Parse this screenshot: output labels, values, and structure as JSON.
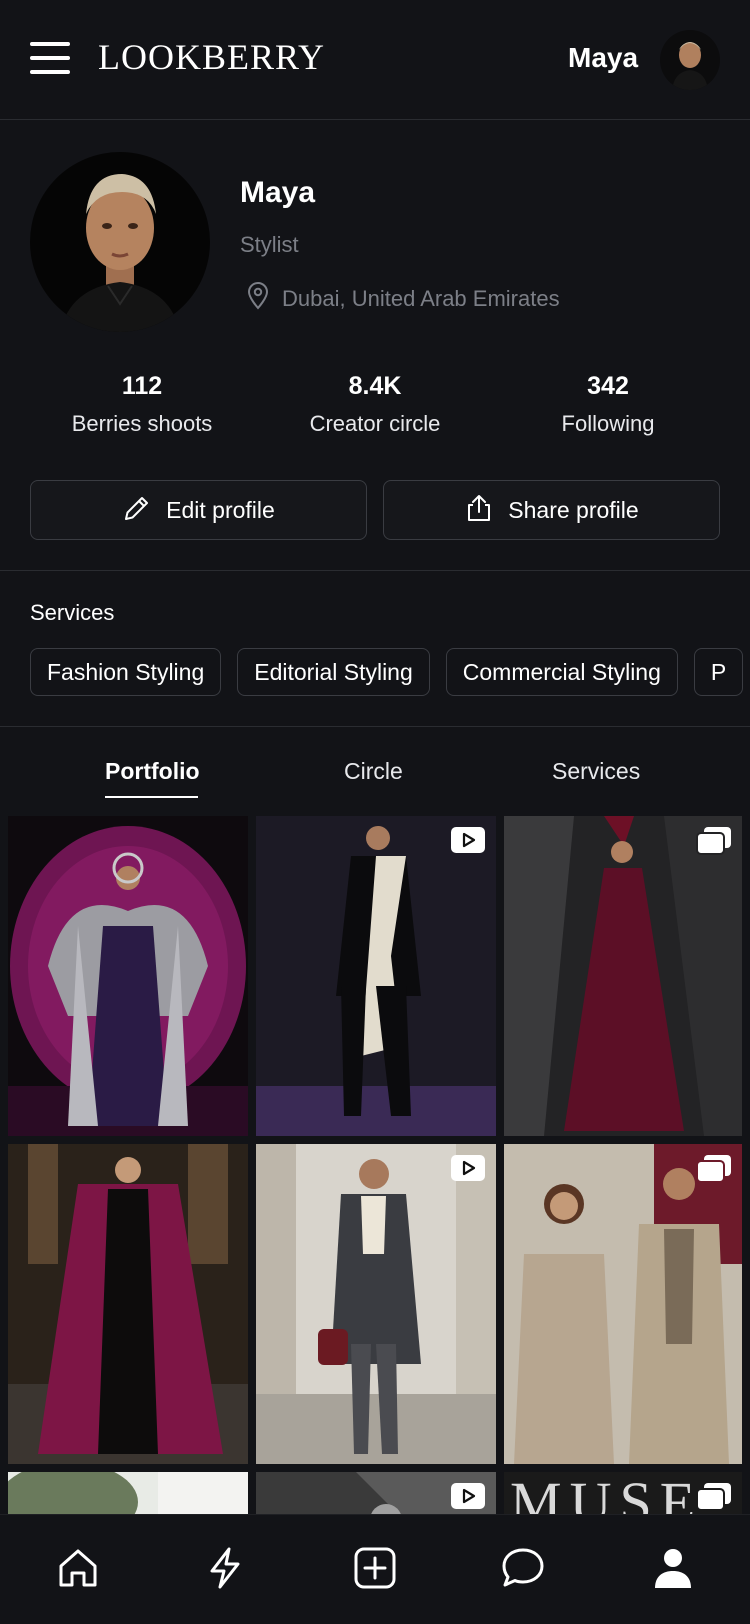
{
  "header": {
    "brand": "LOOKBERRY",
    "username": "Maya"
  },
  "profile": {
    "name": "Maya",
    "role": "Stylist",
    "location": "Dubai, United Arab Emirates"
  },
  "stats": [
    {
      "value": "112",
      "label": "Berries shoots"
    },
    {
      "value": "8.4K",
      "label": "Creator circle"
    },
    {
      "value": "342",
      "label": "Following"
    }
  ],
  "actions": {
    "edit": "Edit profile",
    "share": "Share profile"
  },
  "services": {
    "title": "Services",
    "chips": [
      "Fashion Styling",
      "Editorial Styling",
      "Commercial Styling",
      "P"
    ]
  },
  "tabs": {
    "items": [
      "Portfolio",
      "Circle",
      "Services"
    ],
    "active": "Portfolio"
  },
  "grid": {
    "items": [
      {
        "media": "image",
        "badge": "none"
      },
      {
        "media": "video",
        "badge": "play-icon"
      },
      {
        "media": "gallery",
        "badge": "gallery-icon"
      },
      {
        "media": "image",
        "badge": "none"
      },
      {
        "media": "video",
        "badge": "play-icon"
      },
      {
        "media": "gallery",
        "badge": "gallery-icon"
      },
      {
        "media": "image",
        "badge": "none"
      },
      {
        "media": "video",
        "badge": "play-icon"
      },
      {
        "media": "gallery",
        "badge": "gallery-icon",
        "visible_text": "MUSE"
      }
    ]
  },
  "bottom_nav": [
    "home-icon",
    "lightning-icon",
    "add-icon",
    "chat-icon",
    "profile-icon"
  ],
  "colors": {
    "background": "#121317",
    "border": "#3a3c42",
    "muted_text": "#7c7f87",
    "accent_magenta": "#8a1a5c"
  }
}
